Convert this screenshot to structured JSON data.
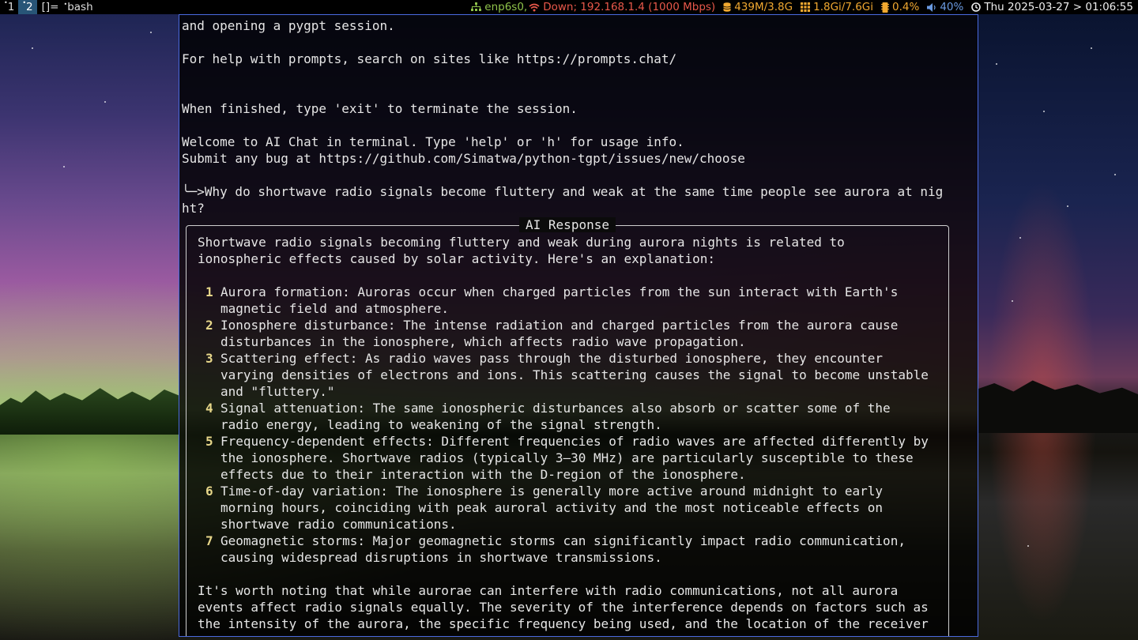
{
  "statusbar": {
    "workspaces": [
      {
        "label": "1",
        "active": false
      },
      {
        "label": "2",
        "active": true
      }
    ],
    "layout_indicator": "[]=",
    "window_title": "bash",
    "network_interface": "enp6s0,",
    "network_status": "Down; 192.168.1.4 (1000 Mbps)",
    "memory": "439M/3.8G",
    "swap": "1.8Gi/7.6Gi",
    "cpu": "0.4%",
    "volume": "40%",
    "clock": "Thu 2025-03-27 > 01:06:55",
    "colors": {
      "green": "#8fc34a",
      "red": "#e8584a",
      "orange": "#f0a830",
      "blue": "#6a9ae0"
    }
  },
  "terminal": {
    "lines": [
      "and opening a pygpt session.",
      "",
      "For help with prompts, search on sites like https://prompts.chat/",
      "",
      "",
      "When finished, type 'exit' to terminate the session.",
      "",
      "Welcome to AI Chat in terminal. Type 'help' or 'h' for usage info.",
      "Submit any bug at https://github.com/Simatwa/python-tgpt/issues/new/choose",
      "",
      "╰─>Why do shortwave radio signals become fluttery and weak at the same time people see aurora at nig",
      "ht?"
    ],
    "response": {
      "title": "AI Response",
      "intro": [
        "Shortwave radio signals becoming fluttery and weak during aurora nights is related to",
        "ionospheric effects caused by solar activity. Here's an explanation:"
      ],
      "items": [
        {
          "num": "1",
          "lines": [
            "Aurora formation: Auroras occur when charged particles from the sun interact with Earth's",
            "magnetic field and atmosphere."
          ]
        },
        {
          "num": "2",
          "lines": [
            "Ionosphere disturbance: The intense radiation and charged particles from the aurora cause",
            "disturbances in the ionosphere, which affects radio wave propagation."
          ]
        },
        {
          "num": "3",
          "lines": [
            "Scattering effect: As radio waves pass through the disturbed ionosphere, they encounter",
            "varying densities of electrons and ions. This scattering causes the signal to become unstable",
            "and \"fluttery.\""
          ]
        },
        {
          "num": "4",
          "lines": [
            "Signal attenuation: The same ionospheric disturbances also absorb or scatter some of the",
            "radio energy, leading to weakening of the signal strength."
          ]
        },
        {
          "num": "5",
          "lines": [
            "Frequency-dependent effects: Different frequencies of radio waves are affected differently by",
            "the ionosphere. Shortwave radios (typically 3–30 MHz) are particularly susceptible to these",
            "effects due to their interaction with the D-region of the ionosphere."
          ]
        },
        {
          "num": "6",
          "lines": [
            "Time-of-day variation: The ionosphere is generally more active around midnight to early",
            "morning hours, coinciding with peak auroral activity and the most noticeable effects on",
            "shortwave radio communications."
          ]
        },
        {
          "num": "7",
          "lines": [
            "Geomagnetic storms: Major geomagnetic storms can significantly impact radio communication,",
            "causing widespread disruptions in shortwave transmissions."
          ]
        }
      ],
      "outro": [
        "It's worth noting that while aurorae can interfere with radio communications, not all aurora",
        "events affect radio signals equally. The severity of the interference depends on factors such as",
        "the intensity of the aurora, the specific frequency being used, and the location of the receiver"
      ]
    }
  }
}
